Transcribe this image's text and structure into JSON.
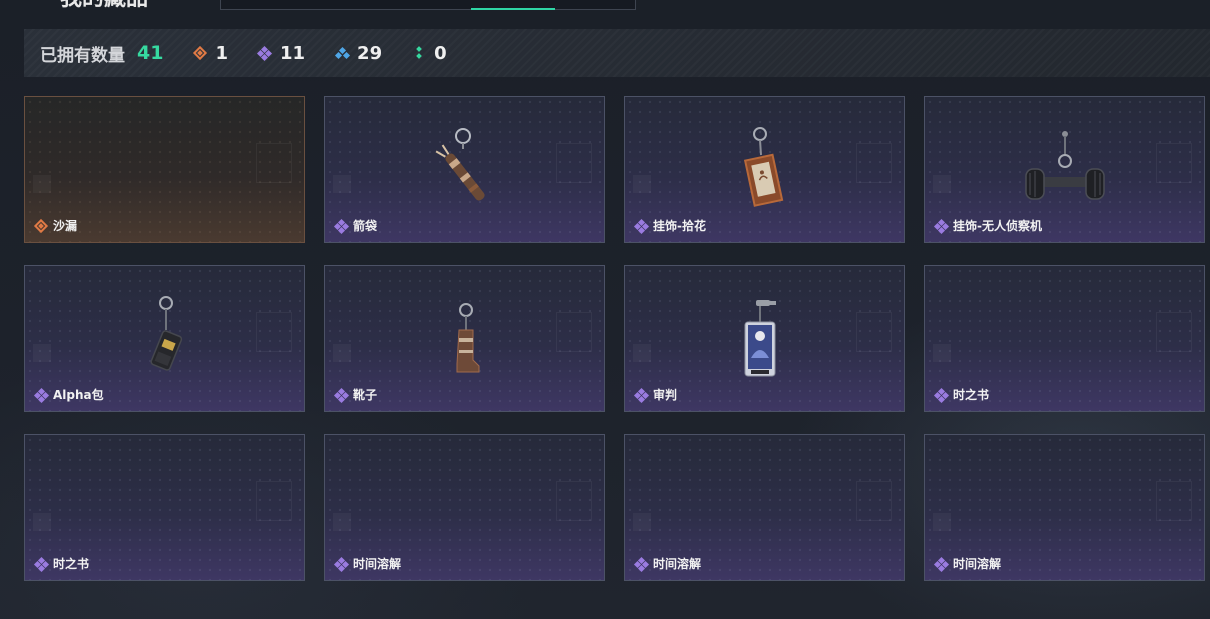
{
  "header": {
    "title": "我的藏品",
    "tabs": [
      "tab-1",
      "tab-2",
      "tab-3",
      "tab-4"
    ],
    "active_tab_index": 2
  },
  "stats": {
    "owned_label": "已拥有数量",
    "owned_count": "41",
    "rarities": [
      {
        "icon": "orange-diamond-icon",
        "color": "#e07a45",
        "count": "1"
      },
      {
        "icon": "purple-diamond-icon",
        "color": "#9a7be0",
        "count": "11"
      },
      {
        "icon": "blue-diamond-icon",
        "color": "#4fa6e6",
        "count": "29"
      },
      {
        "icon": "green-diamond-icon",
        "color": "#36d9a0",
        "count": "0"
      }
    ]
  },
  "items": [
    {
      "name": "沙漏",
      "rarity": "orange",
      "art": "none"
    },
    {
      "name": "箭袋",
      "rarity": "purple",
      "art": "quiver-keychain-icon"
    },
    {
      "name": "挂饰-拾花",
      "rarity": "purple",
      "art": "flower-card-keychain-icon"
    },
    {
      "name": "挂饰-无人侦察机",
      "rarity": "purple",
      "art": "drone-keychain-icon"
    },
    {
      "name": "Alpha包",
      "rarity": "purple",
      "art": "alpha-bag-keychain-icon"
    },
    {
      "name": "靴子",
      "rarity": "purple",
      "art": "boot-keychain-icon"
    },
    {
      "name": "审判",
      "rarity": "purple",
      "art": "judgment-card-keychain-icon"
    },
    {
      "name": "时之书",
      "rarity": "purple",
      "art": "none"
    },
    {
      "name": "时之书",
      "rarity": "purple",
      "art": "none"
    },
    {
      "name": "时间溶解",
      "rarity": "purple",
      "art": "none"
    },
    {
      "name": "时间溶解",
      "rarity": "purple",
      "art": "none"
    },
    {
      "name": "时间溶解",
      "rarity": "purple",
      "art": "none"
    }
  ],
  "colors": {
    "accent_green": "#36d9a0",
    "rarity_orange": "#e07a45",
    "rarity_purple": "#9a7be0",
    "rarity_blue": "#4fa6e6"
  }
}
